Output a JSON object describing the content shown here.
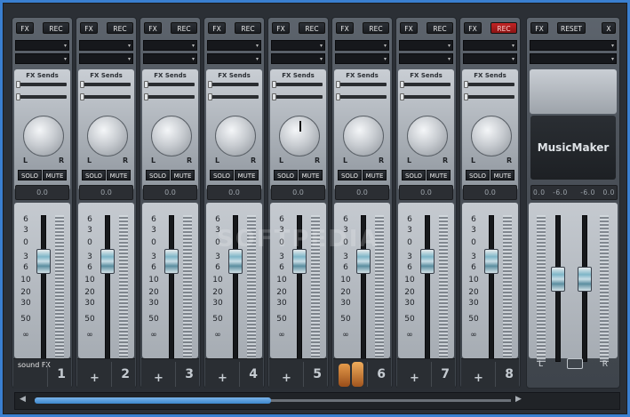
{
  "app": {
    "logo_text": "MusicMaker",
    "watermark": "SOFTPEDIA"
  },
  "channels": [
    {
      "id": "1",
      "fx": "FX",
      "rec": "REC",
      "rec_active": false,
      "fx_sends_label": "FX Sends",
      "solo": "SOLO",
      "mute": "MUTE",
      "pan_l": "L",
      "pan_r": "R",
      "value": "0.0",
      "number": "1",
      "has_plus": false,
      "instrument": "sound FX"
    },
    {
      "id": "2",
      "fx": "FX",
      "rec": "REC",
      "rec_active": false,
      "fx_sends_label": "FX Sends",
      "solo": "SOLO",
      "mute": "MUTE",
      "pan_l": "L",
      "pan_r": "R",
      "value": "0.0",
      "number": "2",
      "has_plus": true
    },
    {
      "id": "3",
      "fx": "FX",
      "rec": "REC",
      "rec_active": false,
      "fx_sends_label": "FX Sends",
      "solo": "SOLO",
      "mute": "MUTE",
      "pan_l": "L",
      "pan_r": "R",
      "value": "0.0",
      "number": "3",
      "has_plus": true
    },
    {
      "id": "4",
      "fx": "FX",
      "rec": "REC",
      "rec_active": false,
      "fx_sends_label": "FX Sends",
      "solo": "SOLO",
      "mute": "MUTE",
      "pan_l": "L",
      "pan_r": "R",
      "value": "0.0",
      "number": "4",
      "has_plus": true
    },
    {
      "id": "5",
      "fx": "FX",
      "rec": "REC",
      "rec_active": false,
      "fx_sends_label": "FX Sends",
      "solo": "SOLO",
      "mute": "MUTE",
      "pan_l": "L",
      "pan_r": "R",
      "value": "0.0",
      "number": "5",
      "has_plus": true
    },
    {
      "id": "6",
      "fx": "FX",
      "rec": "REC",
      "rec_active": false,
      "fx_sends_label": "FX Sends",
      "solo": "SOLO",
      "mute": "MUTE",
      "pan_l": "L",
      "pan_r": "R",
      "value": "0.0",
      "number": "6",
      "has_plus": false,
      "instrument": "congas"
    },
    {
      "id": "7",
      "fx": "FX",
      "rec": "REC",
      "rec_active": false,
      "fx_sends_label": "FX Sends",
      "solo": "SOLO",
      "mute": "MUTE",
      "pan_l": "L",
      "pan_r": "R",
      "value": "0.0",
      "number": "7",
      "has_plus": true
    },
    {
      "id": "8",
      "fx": "FX",
      "rec": "REC",
      "rec_active": true,
      "fx_sends_label": "FX Sends",
      "solo": "SOLO",
      "mute": "MUTE",
      "pan_l": "L",
      "pan_r": "R",
      "value": "0.0",
      "number": "8",
      "has_plus": true
    }
  ],
  "fader_scale": [
    "6",
    "3",
    "0",
    "3",
    "6",
    "10",
    "20",
    "30",
    "50",
    "∞"
  ],
  "master": {
    "fx": "FX",
    "reset": "RESET",
    "close": "X",
    "values": [
      "0.0",
      "-6.0",
      "-6.0",
      "0.0"
    ],
    "l": "L",
    "r": "R"
  },
  "colors": {
    "rec_active": "#c22424",
    "accent": "#3d86cc"
  }
}
